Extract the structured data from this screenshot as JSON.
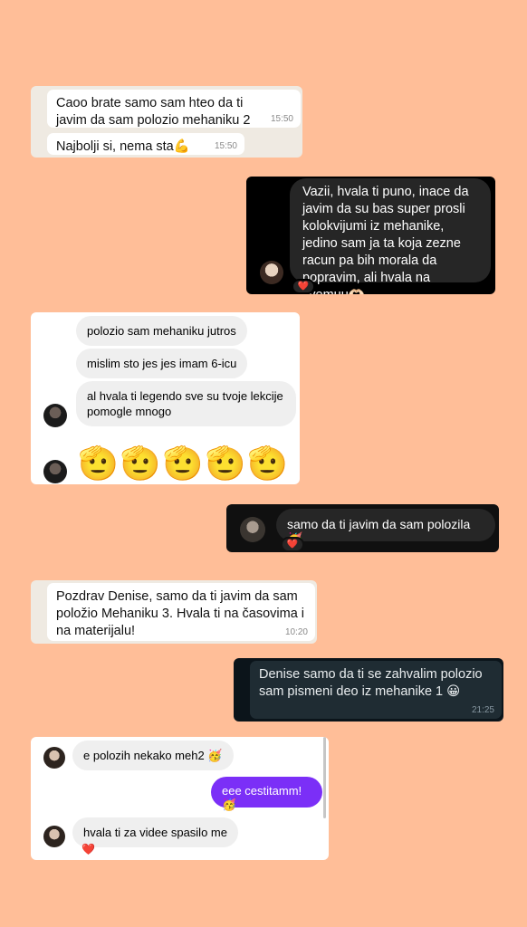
{
  "card1": {
    "msg1": "Caoo brate samo sam hteo da ti javim da sam polozio mehaniku 2",
    "time1": "15:50",
    "msg2": "Najbolji si, nema sta💪",
    "time2": "15:50"
  },
  "card2": {
    "msg": "Vazii, hvala ti puno, inace da javim da su bas super prosli kolokvijumi iz mehanike, jedino sam ja ta koja zezne racun pa bih morala da popravim, ali hvala na svemuu🫶🏻",
    "reaction": "❤️"
  },
  "card3": {
    "msg1": "polozio sam mehaniku jutros",
    "msg2": "mislim sto jes jes imam 6-icu",
    "msg3": "al hvala ti legendo sve su tvoje lekcije pomogle mnogo",
    "emojis": "🫡🫡🫡🫡🫡"
  },
  "card4": {
    "msg": "samo da ti javim da sam polozila 🥳",
    "reaction": "❤️"
  },
  "card5": {
    "msg": "Pozdrav Denise, samo da ti javim da sam položio Mehaniku 3. Hvala ti na časovima i na materijalu!",
    "time": "10:20"
  },
  "card6": {
    "msg": "Denise samo da ti se zahvalim polozio sam pismeni deo iz mehanike 1 😀",
    "time": "21:25"
  },
  "card7": {
    "msg1": "e polozih nekako meh2 🥳",
    "sent": "eee cestitamm! 🥳",
    "msg2": "hvala ti za videe spasilo me",
    "reaction": "❤️"
  },
  "colors": {
    "background": "#FFBE98",
    "ig_purple": "#7b2ff7",
    "wa_dark": "#0b141a"
  }
}
